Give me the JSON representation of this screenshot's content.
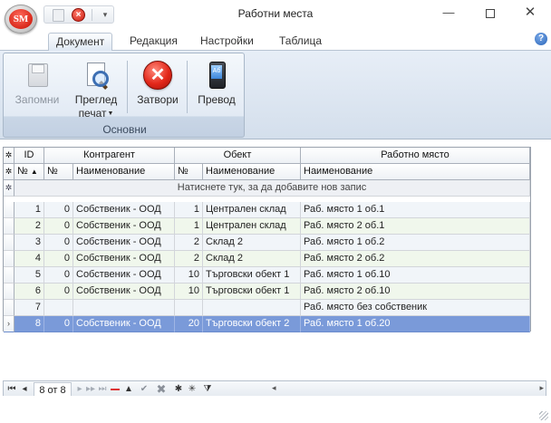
{
  "window": {
    "title": "Работни места",
    "app_logo": "SM",
    "controls": {
      "minimize": "—",
      "maximize": "",
      "close": "✕"
    }
  },
  "quick_access": {
    "save_icon": "save-icon",
    "close_icon": "close-icon",
    "close_glyph": "×",
    "more": "▾"
  },
  "ribbon": {
    "tabs": [
      {
        "label": "Документ",
        "active": true
      },
      {
        "label": "Редакция",
        "active": false
      },
      {
        "label": "Настройки",
        "active": false
      },
      {
        "label": "Таблица",
        "active": false
      }
    ],
    "help": "?",
    "group_label": "Основни",
    "buttons": {
      "save": "Запомни",
      "preview_line1": "Преглед",
      "preview_line2": "печат",
      "close": "Затвори",
      "close_glyph": "✕",
      "translate": "Превод",
      "translate_screen": "Aб"
    }
  },
  "grid": {
    "band_headers": {
      "id": "ID",
      "contractor": "Контрагент",
      "object": "Обект",
      "workplace": "Работно място"
    },
    "column_headers": {
      "id_no": "№",
      "contractor_no": "№",
      "contractor_name": "Наименование",
      "object_no": "№",
      "object_name": "Наименование",
      "workplace_name": "Наименование"
    },
    "indicator_glyph": "✲",
    "new_row_text": "Натиснете тук, за да добавите нов запис",
    "rows": [
      {
        "id": "1",
        "c_no": "0",
        "c_name": "Собственик - ООД",
        "o_no": "1",
        "o_name": "Централен склад",
        "wp": "Раб. място 1 об.1",
        "indicator": ""
      },
      {
        "id": "2",
        "c_no": "0",
        "c_name": "Собственик - ООД",
        "o_no": "1",
        "o_name": "Централен склад",
        "wp": "Раб. място 2 об.1",
        "indicator": ""
      },
      {
        "id": "3",
        "c_no": "0",
        "c_name": "Собственик - ООД",
        "o_no": "2",
        "o_name": "Склад 2",
        "wp": "Раб. място 1 об.2",
        "indicator": ""
      },
      {
        "id": "4",
        "c_no": "0",
        "c_name": "Собственик - ООД",
        "o_no": "2",
        "o_name": "Склад 2",
        "wp": "Раб. място 2 об.2",
        "indicator": ""
      },
      {
        "id": "5",
        "c_no": "0",
        "c_name": "Собственик - ООД",
        "o_no": "10",
        "o_name": "Търговски обект 1",
        "wp": "Раб. място 1 об.10",
        "indicator": ""
      },
      {
        "id": "6",
        "c_no": "0",
        "c_name": "Собственик - ООД",
        "o_no": "10",
        "o_name": "Търговски обект 1",
        "wp": "Раб. място 2 об.10",
        "indicator": ""
      },
      {
        "id": "7",
        "c_no": "",
        "c_name": "",
        "o_no": "",
        "o_name": "",
        "wp": "Раб. място без собственик",
        "indicator": ""
      },
      {
        "id": "8",
        "c_no": "0",
        "c_name": "Собственик - ООД",
        "o_no": "20",
        "o_name": "Търговски обект 2",
        "wp": "Раб. място 1 об.20",
        "indicator": "›"
      }
    ],
    "selected_row_index": 7
  },
  "navigator": {
    "position": "8 от 8",
    "first": "⏮",
    "prev": "◂",
    "next": "▸",
    "next_page": "▸▸",
    "last": "⏭",
    "up": "▲",
    "post": "✔",
    "cancel": "✖",
    "star1": "✱",
    "star2": "✳",
    "filter": "⧩",
    "scroll_left": "◂",
    "scroll_right": "▸"
  },
  "colors": {
    "selection": "#7a9ad9",
    "accent": "#d8281a"
  }
}
